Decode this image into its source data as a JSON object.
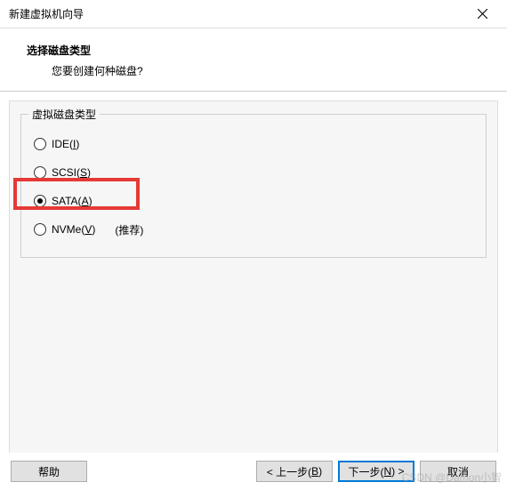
{
  "window": {
    "title": "新建虚拟机向导"
  },
  "header": {
    "title": "选择磁盘类型",
    "subtitle": "您要创建何种磁盘?"
  },
  "group": {
    "legend": "虚拟磁盘类型",
    "options": [
      {
        "prefix": "IDE(",
        "mnemonic": "I",
        "suffix": ")",
        "selected": false,
        "extra": ""
      },
      {
        "prefix": "SCSI(",
        "mnemonic": "S",
        "suffix": ")",
        "selected": false,
        "extra": ""
      },
      {
        "prefix": "SATA(",
        "mnemonic": "A",
        "suffix": ")",
        "selected": true,
        "extra": ""
      },
      {
        "prefix": "NVMe(",
        "mnemonic": "V",
        "suffix": ")",
        "selected": false,
        "extra": "(推荐)"
      }
    ]
  },
  "buttons": {
    "help": "帮助",
    "back_prefix": "< 上一步(",
    "back_mnemonic": "B",
    "back_suffix": ")",
    "next_prefix": "下一步(",
    "next_mnemonic": "N",
    "next_suffix": ") >",
    "cancel": "取消"
  },
  "watermark": "CSDN @Damon小智"
}
